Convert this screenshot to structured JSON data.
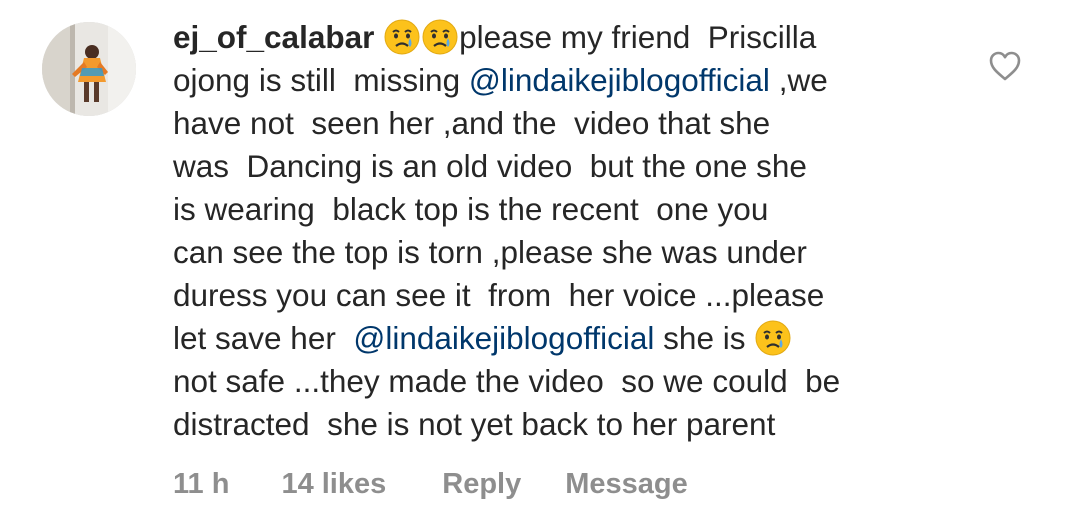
{
  "comment": {
    "username": "ej_of_calabar",
    "avatar_icon": "user-avatar-photo",
    "line1_text": "please my friend  Priscilla",
    "line2_prefix": "ojong is still  missing ",
    "mention": "@lindaikejiblogofficial",
    "line2_suffix": " ,we",
    "line3": "have not  seen her ,and the  video that she",
    "line4": "was  Dancing is an old video  but the one she",
    "line5": "is wearing  black top is the recent  one you",
    "line6": "can see the top is torn ,please she was under",
    "line7": "duress you can see it  from  her voice ...please",
    "line8_prefix": "let save her  ",
    "line8_suffix": " she is ",
    "line9": "not safe ...they made the video  so we could  be",
    "line10": "distracted  she is not yet back to her parent",
    "emoji_name": "crying-face-emoji"
  },
  "meta": {
    "time": "11 h",
    "likes": "14 likes",
    "reply": "Reply",
    "message": "Message"
  },
  "like_icon": "heart-outline-icon",
  "colors": {
    "text": "#262626",
    "mention": "#00376b",
    "meta": "#8e8e8e",
    "emoji_face": "#fcc21b",
    "tear": "#5aa9e6"
  }
}
